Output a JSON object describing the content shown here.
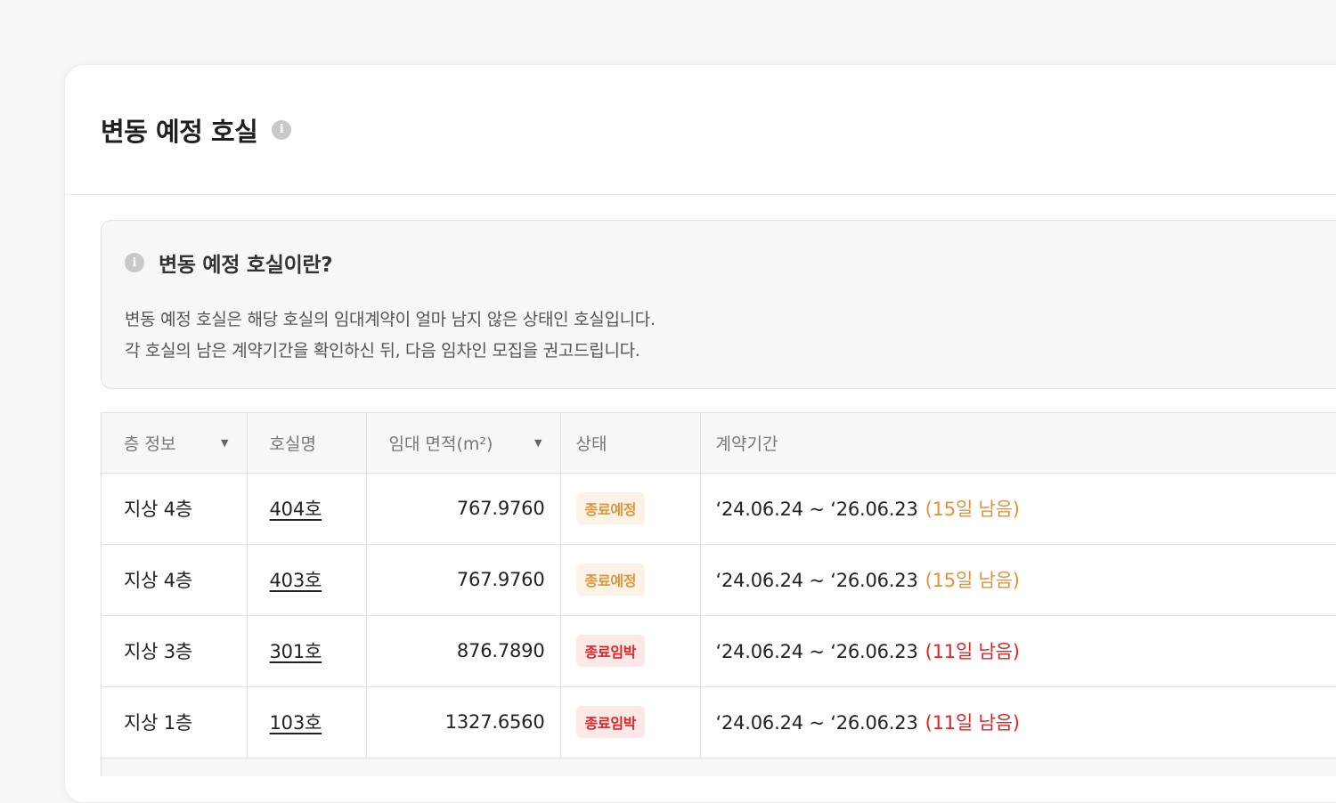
{
  "header": {
    "title": "변동 예정 호실",
    "info_icon": "info-circle-icon"
  },
  "notice": {
    "title": "변동 예정 호실이란?",
    "lines": [
      "변동 예정 호실은 해당 호실의 임대계약이 얼마 남지 않은 상태인 호실입니다.",
      "각 호실의 남은 계약기간을 확인하신 뒤, 다음 임차인 모집을 권고드립니다."
    ]
  },
  "table": {
    "columns": [
      {
        "label": "층 정보",
        "sortable": true
      },
      {
        "label": "호실명",
        "sortable": false
      },
      {
        "label": "임대 면적(m²)",
        "sortable": true
      },
      {
        "label": "상태",
        "sortable": false
      },
      {
        "label": "계약기간",
        "sortable": false
      }
    ],
    "rows": [
      {
        "floor": "지상 4층",
        "room": "404호",
        "area": "767.9760",
        "status": "종료예정",
        "status_type": "soon",
        "period": "‘24.06.24 ~ ‘26.06.23",
        "remaining": "(15일 남음)"
      },
      {
        "floor": "지상 4층",
        "room": "403호",
        "area": "767.9760",
        "status": "종료예정",
        "status_type": "soon",
        "period": "‘24.06.24 ~ ‘26.06.23",
        "remaining": "(15일 남음)"
      },
      {
        "floor": "지상 3층",
        "room": "301호",
        "area": "876.7890",
        "status": "종료임박",
        "status_type": "urgent",
        "period": "‘24.06.24 ~ ‘26.06.23",
        "remaining": "(11일 남음)"
      },
      {
        "floor": "지상 1층",
        "room": "103호",
        "area": "1327.6560",
        "status": "종료임박",
        "status_type": "urgent",
        "period": "‘24.06.24 ~ ‘26.06.23",
        "remaining": "(11일 남음)"
      }
    ]
  },
  "colors": {
    "soon": "#e0943b",
    "urgent": "#e02424"
  }
}
